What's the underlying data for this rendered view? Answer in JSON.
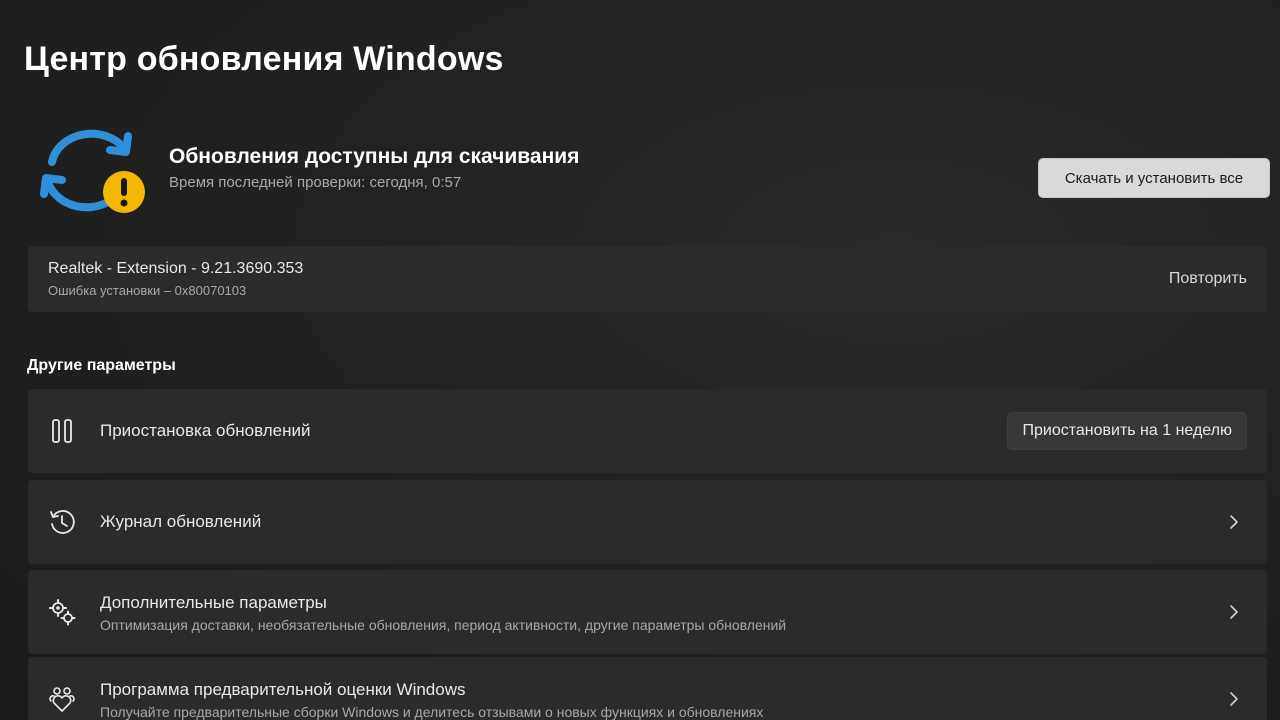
{
  "page": {
    "title": "Центр обновления Windows"
  },
  "status": {
    "icon": "sync-warning-icon",
    "title": "Обновления доступны для скачивания",
    "last_check": "Время последней проверки: сегодня, 0:57",
    "action_label": "Скачать и установить все",
    "colors": {
      "sync_blue": "#2f8fd8",
      "warning_yellow": "#f5b800"
    }
  },
  "failed_update": {
    "name": "Realtek - Extension - 9.21.3690.353",
    "error": "Ошибка установки – 0x80070103",
    "retry_label": "Повторить"
  },
  "other_options": {
    "heading": "Другие параметры",
    "items": [
      {
        "icon": "pause-icon",
        "label": "Приостановка обновлений",
        "button_label": "Приостановить на 1 неделю"
      },
      {
        "icon": "history-icon",
        "label": "Журнал обновлений"
      },
      {
        "icon": "gears-icon",
        "label": "Дополнительные параметры",
        "description": "Оптимизация доставки, необязательные обновления, период активности, другие параметры обновлений"
      },
      {
        "icon": "insider-hearts-icon",
        "label": "Программа предварительной оценки Windows",
        "description": "Получайте предварительные сборки Windows и делитесь отзывами о новых функциях и обновлениях"
      }
    ]
  }
}
